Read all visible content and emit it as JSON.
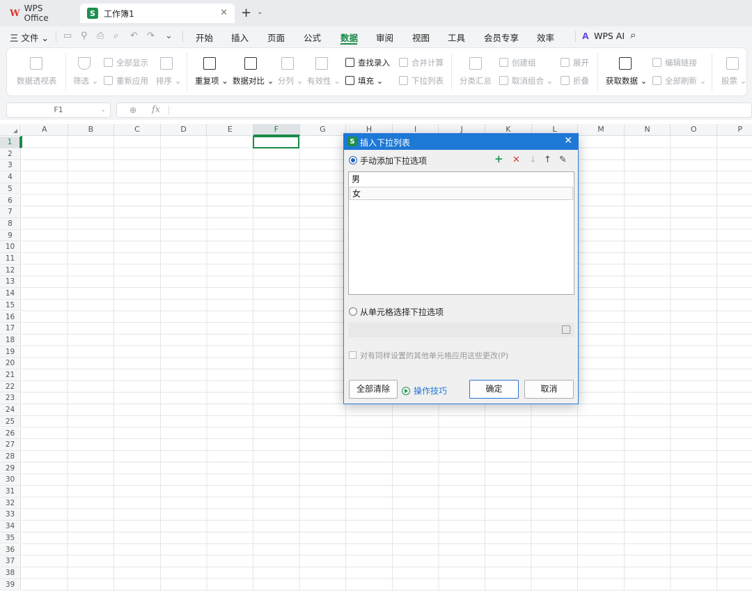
{
  "titlebar": {
    "app_tab": "WPS Office",
    "app_logo": "W",
    "doc_tab": "工作簿1",
    "doc_logo": "S",
    "close_glyph": "✕",
    "new_tab_glyph": "+",
    "new_tab_dd": "⌄"
  },
  "menubar": {
    "file": "三 文件 ⌄",
    "items": [
      "开始",
      "插入",
      "页面",
      "公式",
      "数据",
      "审阅",
      "视图",
      "工具",
      "会员专享",
      "效率"
    ],
    "active": "数据",
    "wps_ai": "WPS AI",
    "search_icon": "⌕"
  },
  "ribbon": {
    "pivot": "数据透视表",
    "filter": "筛选 ⌄",
    "show_all": "全部显示",
    "reapply": "重新应用",
    "sort": "排序 ⌄",
    "duplicates": "重复项 ⌄",
    "compare": "数据对比 ⌄",
    "split": "分列 ⌄",
    "validity": "有效性 ⌄",
    "find_entry": "查找录入",
    "fill": "填充 ⌄",
    "merge_calc": "合并计算",
    "dropdown_list": "下拉列表",
    "subtotal": "分类汇总",
    "create_group": "创建组",
    "ungroup": "取消组合 ⌄",
    "expand": "展开",
    "collapse": "折叠",
    "get_data": "获取数据 ⌄",
    "edit_links": "编辑链接",
    "refresh_all": "全部刷新 ⌄",
    "stocks": "股票 ⌄"
  },
  "formula_bar": {
    "name_box": "F1",
    "fx": "fx"
  },
  "grid": {
    "columns": [
      "A",
      "B",
      "C",
      "D",
      "E",
      "F",
      "G",
      "H",
      "I",
      "J",
      "K",
      "L",
      "M",
      "N",
      "O",
      "P"
    ],
    "selected_column": "F",
    "row_count": 39,
    "selected_row": 1
  },
  "dialog": {
    "title": "插入下拉列表",
    "logo": "S",
    "close_glyph": "✕",
    "manual_option": "手动添加下拉选项",
    "tool_add": "+",
    "tool_delete": "✕",
    "tool_down": "↓",
    "tool_up": "↑",
    "tool_edit": "✎",
    "items": [
      "男",
      "女"
    ],
    "cell_option": "从单元格选择下拉选项",
    "apply_same": "对有同样设置的其他单元格应用这些更改(P)",
    "clear_all": "全部清除",
    "tips": "操作技巧",
    "ok": "确定",
    "cancel": "取消"
  }
}
